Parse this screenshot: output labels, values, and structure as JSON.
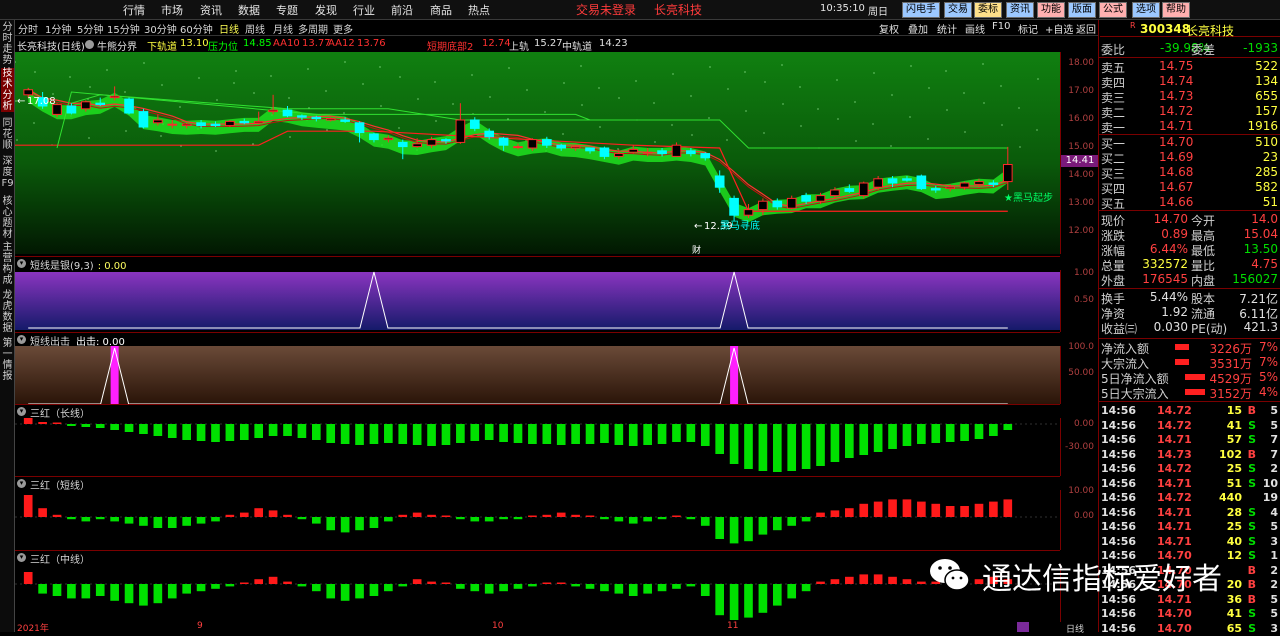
{
  "topbar": {
    "menus": [
      "行情",
      "市场",
      "资讯",
      "数据",
      "专题",
      "发现",
      "行业",
      "前沿",
      "商品",
      "热点"
    ],
    "status": "交易未登录",
    "stock_name": "长亮科技",
    "time": "10:35:10",
    "weekday": "周日",
    "buttons": [
      "闪电手",
      "交易",
      "委标",
      "资讯",
      "功能",
      "版面",
      "公式",
      "选项",
      "帮助"
    ]
  },
  "leftnav": [
    "分时走势",
    "技术分析",
    "同花顺",
    "深度F9",
    "核心题材",
    "主营构成",
    "龙虎数据",
    "第一情报"
  ],
  "periods": [
    "分时",
    "1分钟",
    "5分钟",
    "15分钟",
    "30分钟",
    "60分钟",
    "日线",
    "周线",
    "月线",
    "多周期",
    "更多"
  ],
  "period_active": "日线",
  "toolbar_right": [
    "复权",
    "叠加",
    "统计",
    "画线",
    "F10",
    "标记",
    "+自选",
    "返回"
  ],
  "main_header": {
    "title": "长亮科技(日线)",
    "indicator": "牛熊分界",
    "lower_label": "下轨道",
    "lower_value": "13.10",
    "pressure_label": "压力位",
    "pressure_value": "14.85",
    "aa10_label": "AA10",
    "aa10_value": "13.77",
    "aa12_label": "AA12",
    "aa12_value": "13.76",
    "bottom_label": "短期底部2",
    "bottom_value": "12.74",
    "upper_label": "上轨",
    "upper_value": "15.27",
    "mid_label": "中轨道",
    "mid_value": "14.23"
  },
  "main_annotations": {
    "high_price": "17.08",
    "low_price": "12.39",
    "low_text": "黑马寻底",
    "signal_text": "★黑马起步",
    "cai_marker": "财",
    "current_price": "14.41"
  },
  "main_yticks": [
    "18.00",
    "17.00",
    "16.00",
    "15.00",
    "14.00",
    "13.00",
    "12.00"
  ],
  "panels": [
    {
      "title": "短线是银(9,3)",
      "value": ": 0.00",
      "yticks": [
        "1.00",
        "0.50"
      ]
    },
    {
      "title": "短线出击",
      "value": "出击: 0.00",
      "yticks": [
        "100.0",
        "50.00"
      ]
    },
    {
      "title": "三红（长线）",
      "value": "",
      "yticks": [
        "0.00",
        "-30.00"
      ]
    },
    {
      "title": "三红（短线）",
      "value": "",
      "yticks": [
        "10.00",
        "0.00"
      ]
    },
    {
      "title": "三红（中线）",
      "value": "",
      "yticks": []
    }
  ],
  "xaxis": {
    "labels": [
      "2021年",
      "9",
      "10",
      "11"
    ],
    "period": "日线"
  },
  "quote": {
    "code": "300348",
    "name": "长亮科技",
    "weibi_label": "委比",
    "weibi": "-39.98%",
    "weicha_label": "委差",
    "weicha": "-1933",
    "sells": [
      {
        "label": "卖五",
        "price": "14.75",
        "vol": "522"
      },
      {
        "label": "卖四",
        "price": "14.74",
        "vol": "134"
      },
      {
        "label": "卖三",
        "price": "14.73",
        "vol": "655"
      },
      {
        "label": "卖二",
        "price": "14.72",
        "vol": "157"
      },
      {
        "label": "卖一",
        "price": "14.71",
        "vol": "1916"
      }
    ],
    "buys": [
      {
        "label": "买一",
        "price": "14.70",
        "vol": "510"
      },
      {
        "label": "买二",
        "price": "14.69",
        "vol": "23"
      },
      {
        "label": "买三",
        "price": "14.68",
        "vol": "285"
      },
      {
        "label": "买四",
        "price": "14.67",
        "vol": "582"
      },
      {
        "label": "买五",
        "price": "14.66",
        "vol": "51"
      }
    ],
    "stats": [
      {
        "l1": "现价",
        "v1": "14.70",
        "c1": "red",
        "l2": "今开",
        "v2": "14.0",
        "c2": "red"
      },
      {
        "l1": "涨跌",
        "v1": "0.89",
        "c1": "red",
        "l2": "最高",
        "v2": "15.04",
        "c2": "red"
      },
      {
        "l1": "涨幅",
        "v1": "6.44%",
        "c1": "red",
        "l2": "最低",
        "v2": "13.50",
        "c2": "green"
      },
      {
        "l1": "总量",
        "v1": "332572",
        "c1": "yel",
        "l2": "量比",
        "v2": "4.75",
        "c2": "red"
      },
      {
        "l1": "外盘",
        "v1": "176545",
        "c1": "red",
        "l2": "内盘",
        "v2": "156027",
        "c2": "green"
      }
    ],
    "stats2": [
      {
        "l1": "换手",
        "v1": "5.44%",
        "l2": "股本",
        "v2": "7.21亿"
      },
      {
        "l1": "净资",
        "v1": "1.92",
        "l2": "流通",
        "v2": "6.11亿"
      },
      {
        "l1": "收益㈢",
        "v1": "0.030",
        "l2": "PE(动)",
        "v2": "421.3"
      }
    ],
    "flows": [
      {
        "label": "净流入额",
        "value": "3226万",
        "pct": "7%"
      },
      {
        "label": "大宗流入",
        "value": "3531万",
        "pct": "7%"
      },
      {
        "label": "5日净流入额",
        "value": "4529万",
        "pct": "5%"
      },
      {
        "label": "5日大宗流入",
        "value": "3152万",
        "pct": "4%"
      }
    ],
    "ticks": [
      {
        "t": "14:56",
        "p": "14.72",
        "v": "15",
        "d": "B",
        "n": "5"
      },
      {
        "t": "14:56",
        "p": "14.72",
        "v": "41",
        "d": "S",
        "n": "5"
      },
      {
        "t": "14:56",
        "p": "14.71",
        "v": "57",
        "d": "S",
        "n": "7"
      },
      {
        "t": "14:56",
        "p": "14.73",
        "v": "102",
        "d": "B",
        "n": "7"
      },
      {
        "t": "14:56",
        "p": "14.72",
        "v": "25",
        "d": "S",
        "n": "2"
      },
      {
        "t": "14:56",
        "p": "14.71",
        "v": "51",
        "d": "S",
        "n": "10"
      },
      {
        "t": "14:56",
        "p": "14.72",
        "v": "440",
        "d": "",
        "n": "19"
      },
      {
        "t": "14:56",
        "p": "14.71",
        "v": "28",
        "d": "S",
        "n": "4"
      },
      {
        "t": "14:56",
        "p": "14.71",
        "v": "25",
        "d": "S",
        "n": "5"
      },
      {
        "t": "14:56",
        "p": "14.71",
        "v": "40",
        "d": "S",
        "n": "3"
      },
      {
        "t": "14:56",
        "p": "14.70",
        "v": "12",
        "d": "S",
        "n": "1"
      },
      {
        "t": "14:56",
        "p": "14.70",
        "v": "",
        "d": "B",
        "n": "2"
      },
      {
        "t": "14:56",
        "p": "14.70",
        "v": "20",
        "d": "B",
        "n": "2"
      },
      {
        "t": "14:56",
        "p": "14.71",
        "v": "36",
        "d": "B",
        "n": "5"
      },
      {
        "t": "14:56",
        "p": "14.70",
        "v": "41",
        "d": "S",
        "n": "5"
      },
      {
        "t": "14:56",
        "p": "14.70",
        "v": "65",
        "d": "S",
        "n": "3"
      }
    ]
  },
  "watermark": "通达信指标爱好者",
  "colors": {
    "up": "#ff2a2a",
    "down": "#00ffff",
    "bar_up": "#ff1a1a",
    "bar_down": "#00e000",
    "accent": "#7a0000"
  },
  "chart_data": {
    "type": "candlestick",
    "candles": [
      [
        16.9,
        17.08,
        17.15,
        16.8
      ],
      [
        16.8,
        16.5,
        17.0,
        16.4
      ],
      [
        16.2,
        16.55,
        16.6,
        16.1
      ],
      [
        16.5,
        16.25,
        16.6,
        16.2
      ],
      [
        16.4,
        16.65,
        16.7,
        16.3
      ],
      [
        16.6,
        16.55,
        16.8,
        16.5
      ],
      [
        16.8,
        16.85,
        17.2,
        16.7
      ],
      [
        16.75,
        16.25,
        16.8,
        16.2
      ],
      [
        16.3,
        15.75,
        16.4,
        15.7
      ],
      [
        15.9,
        16.0,
        16.2,
        15.8
      ],
      [
        15.85,
        15.85,
        16.0,
        15.7
      ],
      [
        15.8,
        15.85,
        15.9,
        15.7
      ],
      [
        15.9,
        15.8,
        16.0,
        15.7
      ],
      [
        15.85,
        15.8,
        15.95,
        15.75
      ],
      [
        15.8,
        15.95,
        16.0,
        15.75
      ],
      [
        15.95,
        15.9,
        16.05,
        15.85
      ],
      [
        15.9,
        15.95,
        16.3,
        15.85
      ],
      [
        16.3,
        16.35,
        16.9,
        16.2
      ],
      [
        16.35,
        16.15,
        16.5,
        16.1
      ],
      [
        16.15,
        16.1,
        16.2,
        16.0
      ],
      [
        16.1,
        16.05,
        16.15,
        15.95
      ],
      [
        16.0,
        16.05,
        16.1,
        15.95
      ],
      [
        16.0,
        15.95,
        16.1,
        15.9
      ],
      [
        15.9,
        15.55,
        15.95,
        15.2
      ],
      [
        15.5,
        15.3,
        15.55,
        15.2
      ],
      [
        15.3,
        15.35,
        15.45,
        15.2
      ],
      [
        15.2,
        15.05,
        15.3,
        14.6
      ],
      [
        15.05,
        15.15,
        15.35,
        15.0
      ],
      [
        15.1,
        15.3,
        15.4,
        15.0
      ],
      [
        15.3,
        15.25,
        15.35,
        15.15
      ],
      [
        15.2,
        16.0,
        16.6,
        15.15
      ],
      [
        16.0,
        15.7,
        16.1,
        15.6
      ],
      [
        15.6,
        15.4,
        15.7,
        15.3
      ],
      [
        15.35,
        15.1,
        15.4,
        14.9
      ],
      [
        15.05,
        15.05,
        15.15,
        14.95
      ],
      [
        15.0,
        15.3,
        15.35,
        14.9
      ],
      [
        15.3,
        15.1,
        15.4,
        15.0
      ],
      [
        15.1,
        15.0,
        15.15,
        14.9
      ],
      [
        15.0,
        15.05,
        15.1,
        14.9
      ],
      [
        15.0,
        14.9,
        15.0,
        14.8
      ],
      [
        15.0,
        14.7,
        15.05,
        14.6
      ],
      [
        14.7,
        14.8,
        14.95,
        14.6
      ],
      [
        14.85,
        14.95,
        15.1,
        14.8
      ],
      [
        14.85,
        14.85,
        15.0,
        14.7
      ],
      [
        14.9,
        14.8,
        15.0,
        14.7
      ],
      [
        14.7,
        15.1,
        15.2,
        14.7
      ],
      [
        14.9,
        14.8,
        15.0,
        14.7
      ],
      [
        14.8,
        14.65,
        14.85,
        14.55
      ],
      [
        14.0,
        13.6,
        14.2,
        13.4
      ],
      [
        13.2,
        12.6,
        13.3,
        12.39
      ],
      [
        12.6,
        12.8,
        13.0,
        12.5
      ],
      [
        12.8,
        13.1,
        13.2,
        12.6
      ],
      [
        13.1,
        12.9,
        13.2,
        12.8
      ],
      [
        12.85,
        13.2,
        13.3,
        12.8
      ],
      [
        13.3,
        13.1,
        13.4,
        13.0
      ],
      [
        13.1,
        13.3,
        13.4,
        13.0
      ],
      [
        13.3,
        13.5,
        13.6,
        13.2
      ],
      [
        13.55,
        13.45,
        13.7,
        13.4
      ],
      [
        13.3,
        13.75,
        13.8,
        13.2
      ],
      [
        13.6,
        13.9,
        14.0,
        13.5
      ],
      [
        13.9,
        13.75,
        14.0,
        13.6
      ],
      [
        13.9,
        13.85,
        14.0,
        13.8
      ],
      [
        14.0,
        13.55,
        14.05,
        13.5
      ],
      [
        13.55,
        13.5,
        13.65,
        13.4
      ],
      [
        13.55,
        13.6,
        13.7,
        13.45
      ],
      [
        13.6,
        13.75,
        13.8,
        13.5
      ],
      [
        13.7,
        13.8,
        13.9,
        13.6
      ],
      [
        13.75,
        13.7,
        13.85,
        13.6
      ],
      [
        13.8,
        14.41,
        15.04,
        13.5
      ]
    ],
    "short_silver": [
      0,
      0,
      0,
      0,
      0,
      0,
      0,
      0,
      0,
      0,
      0,
      0,
      0,
      0,
      0,
      0,
      0,
      0,
      0,
      0,
      0,
      0,
      0,
      0,
      1,
      0,
      0,
      0,
      0,
      0,
      0,
      0,
      0,
      0,
      0,
      0,
      0,
      0,
      0,
      0,
      0,
      0,
      0,
      0,
      0,
      0,
      0,
      0,
      0,
      1,
      0,
      0,
      0,
      0,
      0,
      0,
      0,
      0,
      0,
      0,
      0,
      0,
      0,
      0,
      0,
      0,
      0,
      0,
      0
    ],
    "short_attack": [
      0,
      0,
      0,
      0,
      0,
      0,
      100,
      0,
      0,
      0,
      0,
      0,
      0,
      0,
      0,
      0,
      0,
      0,
      0,
      0,
      0,
      0,
      0,
      0,
      0,
      0,
      0,
      0,
      0,
      0,
      0,
      0,
      0,
      0,
      0,
      0,
      0,
      0,
      0,
      0,
      0,
      0,
      0,
      0,
      0,
      0,
      0,
      0,
      0,
      100,
      0,
      0,
      0,
      0,
      0,
      0,
      0,
      0,
      0,
      0,
      0,
      0,
      0,
      0,
      0,
      0,
      0,
      0,
      0
    ],
    "three_red_long": [
      8,
      2,
      1,
      -2,
      -3,
      -4,
      -6,
      -8,
      -10,
      -12,
      -14,
      -16,
      -17,
      -18,
      -17,
      -16,
      -14,
      -12,
      -12,
      -14,
      -16,
      -19,
      -20,
      -21,
      -20,
      -19,
      -20,
      -21,
      -22,
      -21,
      -19,
      -17,
      -16,
      -18,
      -19,
      -20,
      -20,
      -21,
      -20,
      -20,
      -19,
      -21,
      -22,
      -21,
      -20,
      -18,
      -18,
      -22,
      -30,
      -40,
      -45,
      -47,
      -48,
      -47,
      -45,
      -42,
      -38,
      -34,
      -31,
      -28,
      -25,
      -22,
      -20,
      -19,
      -18,
      -17,
      -15,
      -12,
      -6
    ],
    "three_red_short": [
      10,
      4,
      1,
      -1,
      -2,
      -1,
      -2,
      -3,
      -4,
      -5,
      -5,
      -4,
      -3,
      -2,
      1,
      2,
      4,
      3,
      1,
      -1,
      -3,
      -6,
      -7,
      -6,
      -5,
      -2,
      1,
      2,
      1,
      0,
      -1,
      -2,
      -2,
      -1,
      -1,
      0,
      1,
      2,
      1,
      0,
      -1,
      -2,
      -3,
      -2,
      -1,
      0,
      -1,
      -4,
      -10,
      -12,
      -11,
      -8,
      -6,
      -4,
      -2,
      2,
      3,
      4,
      6,
      7,
      8,
      8,
      7,
      6,
      5,
      5,
      6,
      7,
      8
    ],
    "three_red_mid": [
      5,
      -4,
      -5,
      -6,
      -6,
      -5,
      -7,
      -8,
      -9,
      -8,
      -6,
      -4,
      -3,
      -2,
      -1,
      0,
      2,
      3,
      1,
      -1,
      -3,
      -6,
      -7,
      -6,
      -5,
      -3,
      -1,
      2,
      1,
      0,
      -2,
      -3,
      -4,
      -3,
      -2,
      -1,
      0,
      0,
      -1,
      -2,
      -3,
      -4,
      -5,
      -4,
      -3,
      -2,
      -1,
      -5,
      -13,
      -15,
      -14,
      -12,
      -9,
      -6,
      -3,
      1,
      2,
      3,
      4,
      4,
      3,
      2,
      1,
      1,
      1,
      1,
      2,
      3,
      2
    ]
  }
}
